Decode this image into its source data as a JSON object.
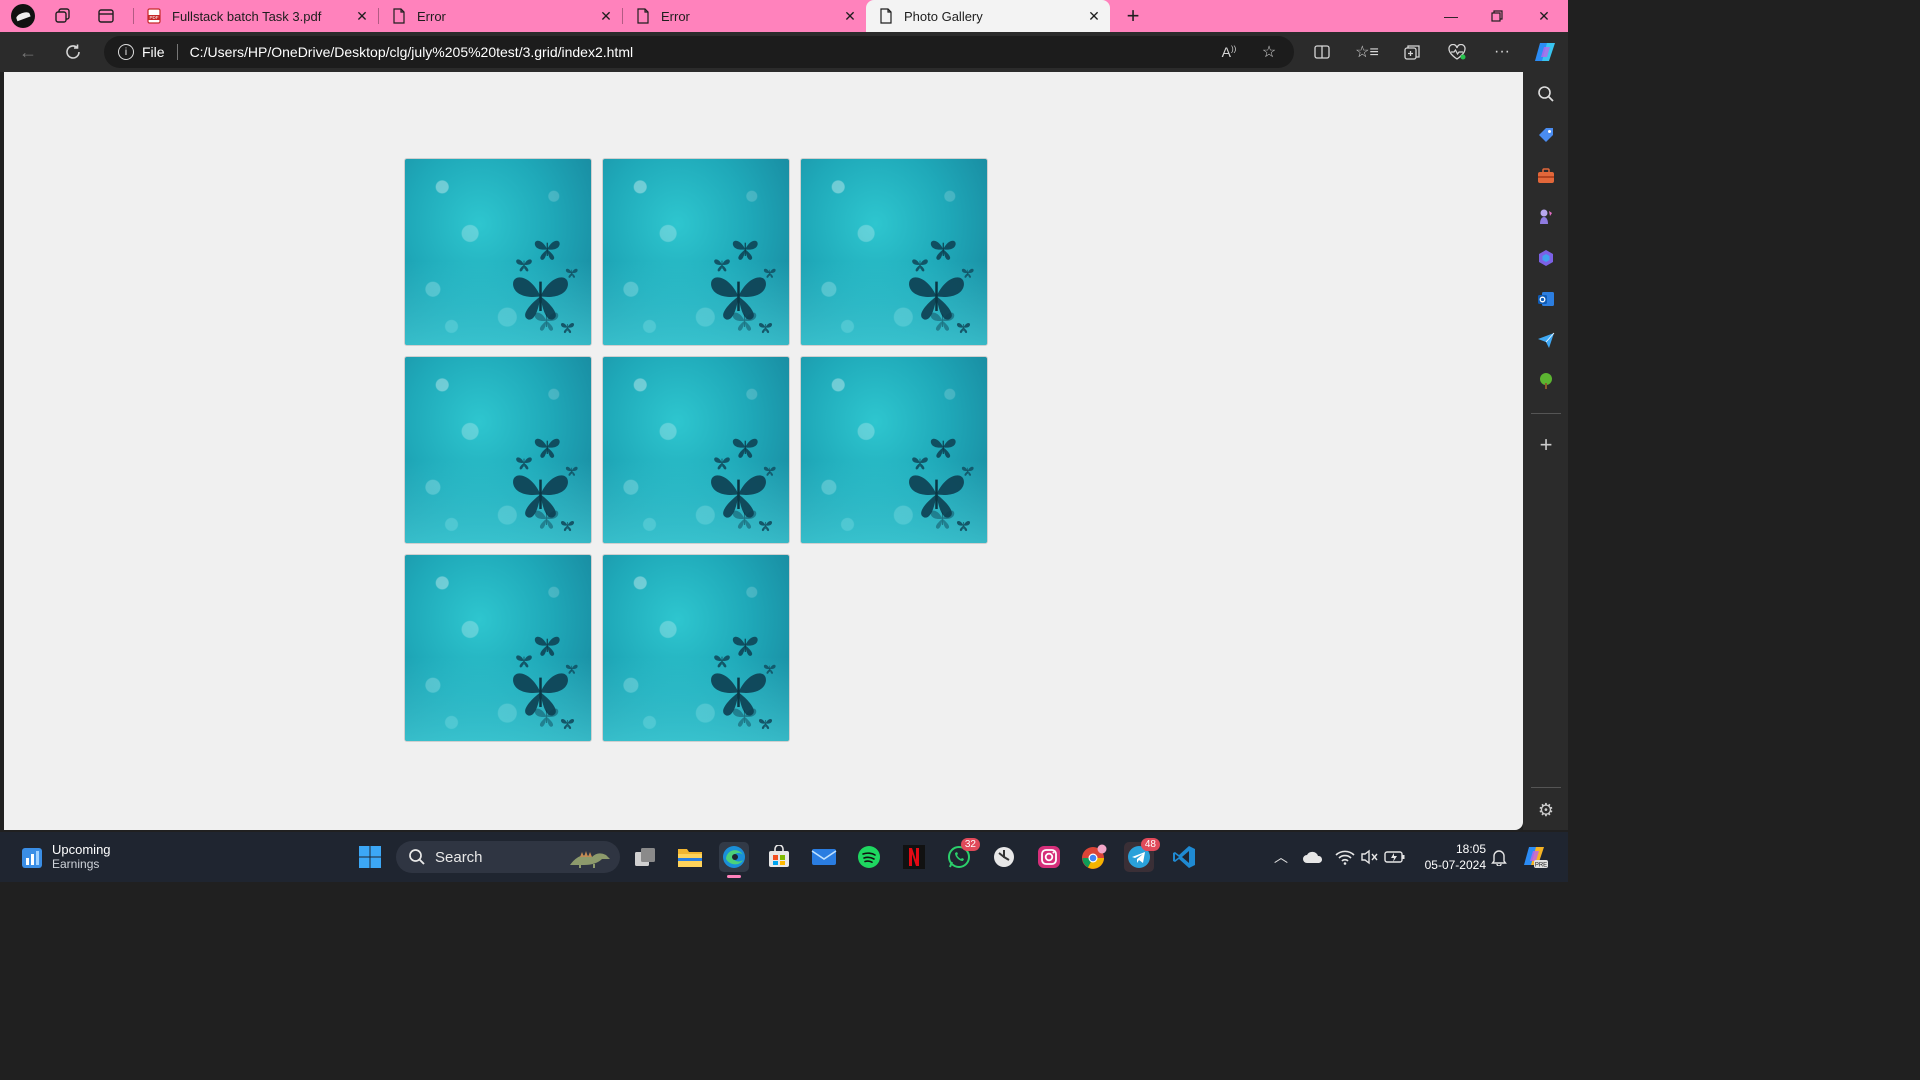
{
  "browser": {
    "tabs": [
      {
        "label": "Fullstack batch Task 3.pdf",
        "icon": "pdf-icon",
        "active": false
      },
      {
        "label": "Error",
        "icon": "page-icon",
        "active": false
      },
      {
        "label": "Error",
        "icon": "page-icon",
        "active": false
      },
      {
        "label": "Photo Gallery",
        "icon": "page-icon",
        "active": true
      }
    ],
    "address": {
      "scheme_label": "File",
      "url": "C:/Users/HP/OneDrive/Desktop/clg/july%205%20test/3.grid/index2.html"
    },
    "tab_bar_color": "#ff82bc"
  },
  "gallery": {
    "photo_count": 8,
    "columns": 3
  },
  "taskbar": {
    "widget_title": "Upcoming",
    "widget_subtitle": "Earnings",
    "search_placeholder": "Search",
    "whatsapp_badge": "32",
    "telegram_badge": "48",
    "time": "18:05",
    "date": "05-07-2024"
  }
}
